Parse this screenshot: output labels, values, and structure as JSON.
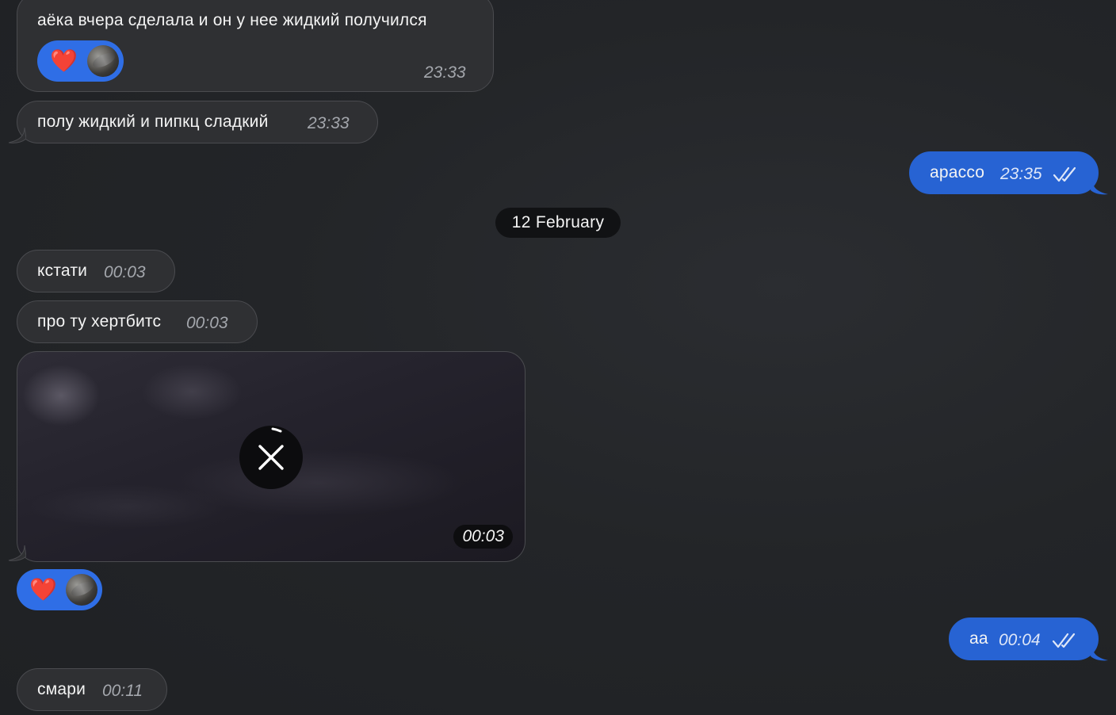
{
  "messages": [
    {
      "text": "аёка вчера сделала и он у нее жидкий получился",
      "time": "23:33"
    },
    {
      "text": "полу жидкий и пипкц сладкий",
      "time": "23:33"
    },
    {
      "text": "арассо",
      "time": "23:35"
    },
    {
      "text": "кстати",
      "time": "00:03"
    },
    {
      "text": "про ту хертбитс",
      "time": "00:03"
    },
    {
      "media_time": "00:03"
    },
    {
      "text": "аа",
      "time": "00:04"
    },
    {
      "text": "смари",
      "time": "00:11"
    }
  ],
  "date_separator": "12 February",
  "reactions": [
    {
      "emoji": "❤️",
      "icon": "heart-icon",
      "color": "#2f6ee6"
    },
    {
      "emoji": "❤️",
      "icon": "heart-icon",
      "color": "#2f6ee6"
    }
  ],
  "colors": {
    "incoming_bubble": "#2f3033",
    "outgoing_bubble": "#2763d3",
    "reaction_pill": "#2f6ee6",
    "date_pill": "#111214"
  },
  "icons": {
    "read_status": "double-check-icon",
    "media_cancel": "close-icon"
  }
}
